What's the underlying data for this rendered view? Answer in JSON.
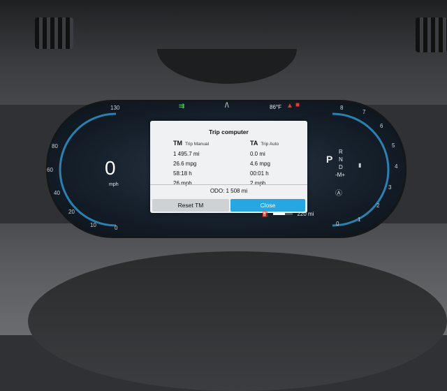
{
  "status_bar": {
    "temperature": "86°F"
  },
  "speedometer": {
    "speed": "0",
    "unit": "mph",
    "scale": [
      "130",
      "80",
      "60",
      "40",
      "20",
      "10",
      "0"
    ]
  },
  "tachometer": {
    "scale": [
      "8",
      "7",
      "6",
      "5",
      "4",
      "3",
      "2",
      "1",
      "0"
    ]
  },
  "gear_selector": {
    "current": "P",
    "options": [
      "R",
      "N",
      "D",
      "-M+"
    ]
  },
  "trip_computer": {
    "title": "Trip computer",
    "manual": {
      "code": "TM",
      "name": "Trip Manual",
      "distance": "1 495.7 mi",
      "economy": "26.6 mpg",
      "time": "58:18 h",
      "speed": "26 mph"
    },
    "auto": {
      "code": "TA",
      "name": "Trip Auto",
      "distance": "0.0 mi",
      "economy": "4.6 mpg",
      "time": "00:01 h",
      "speed": "2 mph"
    },
    "odometer": "ODO:  1 508 mi",
    "reset_label": "Reset TM",
    "close_label": "Close"
  },
  "range": "220 mi",
  "colors": {
    "accent": "#27a7e1",
    "warning": "#e53935",
    "assist": "#2ecc40"
  }
}
